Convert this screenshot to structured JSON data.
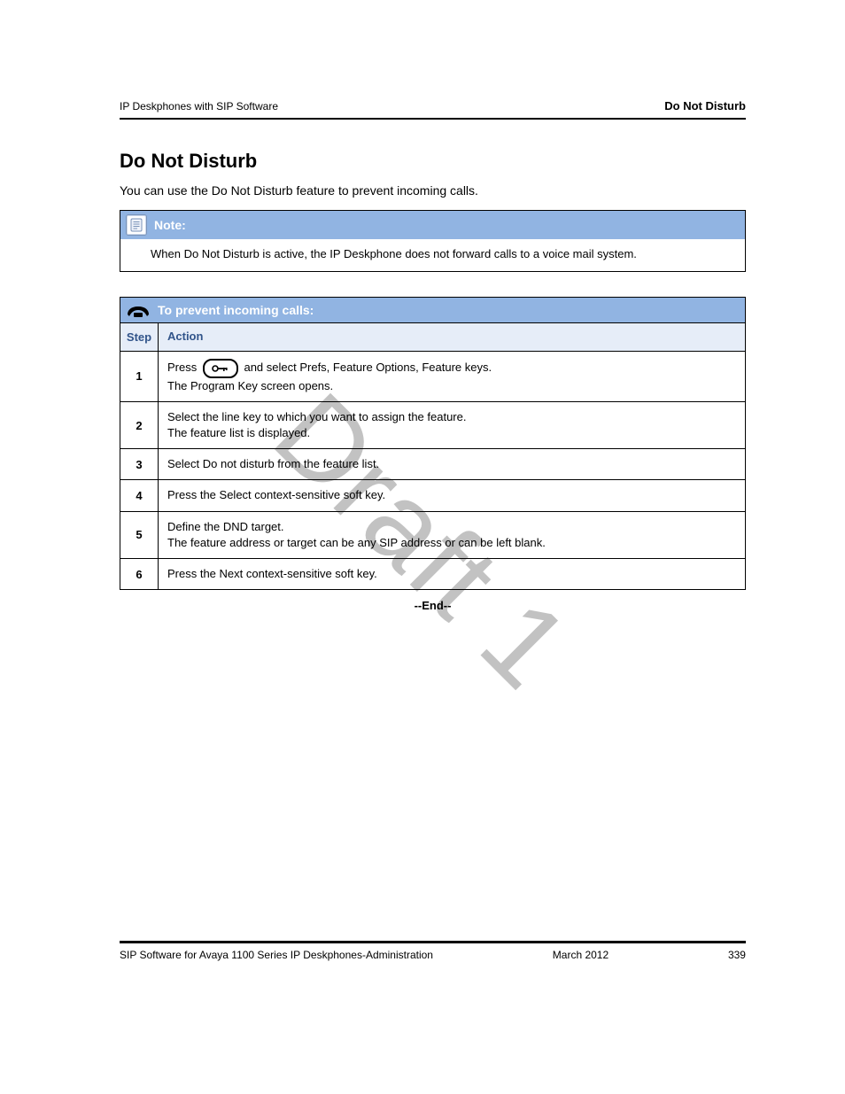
{
  "header": {
    "left": "IP Deskphones with SIP Software",
    "right": "Do Not Disturb"
  },
  "title": "Do Not Disturb",
  "lead": "You can use the Do Not Disturb feature to prevent incoming calls.",
  "note": {
    "label": "Note:",
    "body": "When Do Not Disturb is active, the IP Deskphone does not forward calls to a voice mail system."
  },
  "procedure": {
    "label": "To prevent incoming calls:",
    "header": {
      "step": "Step",
      "action": "Action"
    },
    "rows": [
      {
        "step": "1",
        "pre": "Press ",
        "icon": "services-key",
        "post": " and select Prefs, Feature Options, Feature keys.",
        "line2": "The Program Key screen opens."
      },
      {
        "step": "2",
        "line1": "Select the line key to which you want to assign the feature.",
        "line2": "The feature list is displayed."
      },
      {
        "step": "3",
        "line1": "Select Do not disturb from the feature list."
      },
      {
        "step": "4",
        "line1": "Press the Select context-sensitive soft key."
      },
      {
        "step": "5",
        "line1": "Define the DND target.",
        "line2": "The feature address or target can be any SIP address or can be left blank."
      },
      {
        "step": "6",
        "line1": "Press the Next context-sensitive soft key."
      }
    ],
    "end": "--End--"
  },
  "watermark": "Draft 1",
  "footer": {
    "title": "SIP Software for Avaya 1100 Series IP Deskphones-Administration",
    "date": "March 2012",
    "page": "339"
  }
}
